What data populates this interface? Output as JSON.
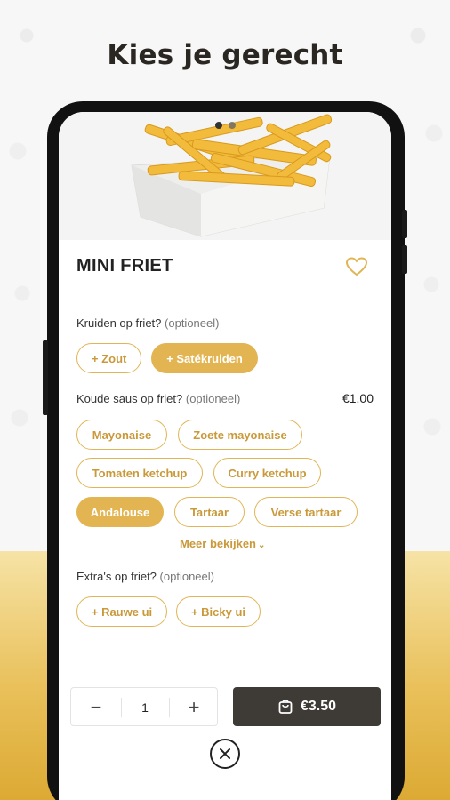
{
  "promo": {
    "headline": "Kies je gerecht"
  },
  "hero": {
    "carousel_pages": 2,
    "active_page": 0,
    "image_label": "fries in tray"
  },
  "product": {
    "title": "MINI FRIET",
    "favorite": false
  },
  "sections": [
    {
      "label": "Kruiden op friet?",
      "optional": "(optioneel)",
      "price": "",
      "options": [
        {
          "label": "+ Zout",
          "selected": false
        },
        {
          "label": "+ Satékruiden",
          "selected": true
        }
      ]
    },
    {
      "label": "Koude saus op friet?",
      "optional": "(optioneel)",
      "price": "€1.00",
      "options": [
        {
          "label": "Mayonaise",
          "selected": false
        },
        {
          "label": "Zoete mayonaise",
          "selected": false
        },
        {
          "label": "Tomaten ketchup",
          "selected": false
        },
        {
          "label": "Curry ketchup",
          "selected": false
        },
        {
          "label": "Andalouse",
          "selected": true
        },
        {
          "label": "Tartaar",
          "selected": false
        },
        {
          "label": "Verse tartaar",
          "selected": false
        }
      ],
      "more_label": "Meer bekijken"
    },
    {
      "label": "Extra's op friet?",
      "optional": "(optioneel)",
      "price": "",
      "options": [
        {
          "label": "+ Rauwe ui",
          "selected": false
        },
        {
          "label": "+ Bicky ui",
          "selected": false
        }
      ]
    }
  ],
  "cart": {
    "minus": "−",
    "quantity": "1",
    "plus": "+",
    "total": "€3.50"
  },
  "icons": {
    "heart": "heart-icon",
    "bag": "shopping-bag-icon",
    "close": "close-icon",
    "chevron": "chevron-down-icon"
  },
  "colors": {
    "accent": "#e3b552",
    "accent_text": "#c9993a",
    "dark_button": "#3e3a36",
    "gold_band": "#e9c05a"
  }
}
